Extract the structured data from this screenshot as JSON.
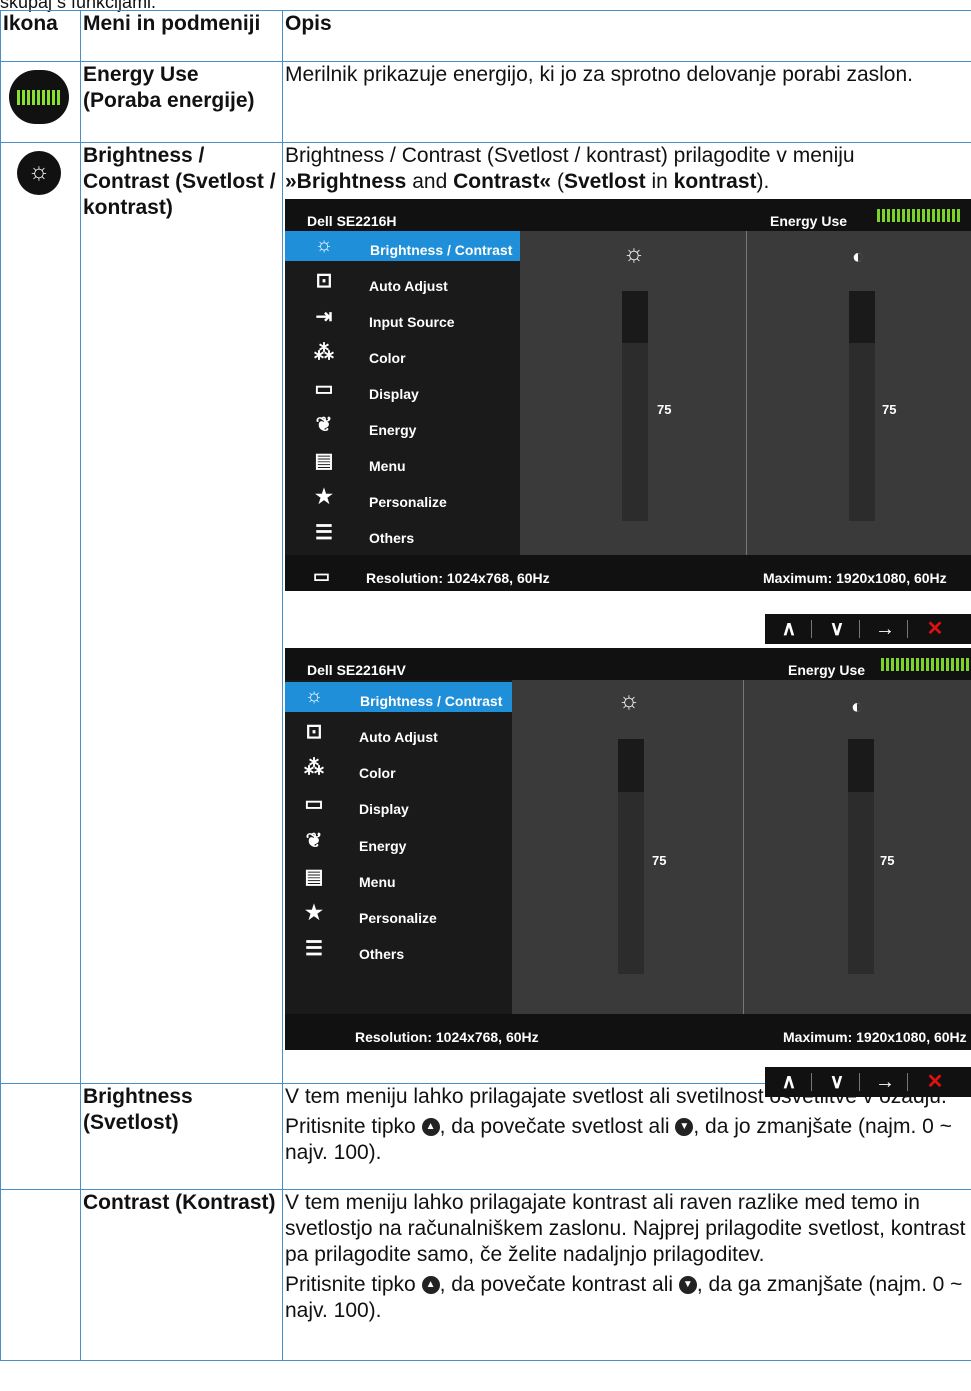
{
  "intro_text": "skupaj s funkcijami.",
  "table": {
    "headers": [
      "Ikona",
      "Meni in podmeniji",
      "Opis"
    ],
    "energy": {
      "icon": "energy-meter-icon",
      "name": "Energy Use (Poraba energije)",
      "desc": "Merilnik prikazuje energijo, ki jo za sprotno delovanje porabi zaslon."
    },
    "brightness_contrast": {
      "icon": "brightness-sun-icon",
      "name": "Brightness / Contrast (Svetlost / kontrast)",
      "desc_parts": [
        "Brightness / Contrast (Svetlost / kontrast) prilagodite v meniju ",
        "»Brightness",
        " and ",
        "Contrast«",
        " (",
        "Svetlost",
        " in ",
        "kontrast",
        ")."
      ]
    },
    "brightness": {
      "name": "Brightness (Svetlost)",
      "p1": "V tem meniju lahko prilagajate svetlost ali svetilnost osvetlitve v ozadju.",
      "p2a": "Pritisnite tipko ",
      "p2b": ", da povečate svetlost ali ",
      "p2c": ", da jo zmanjšate (najm. 0 ~ najv. 100)."
    },
    "contrast": {
      "name": "Contrast (Kontrast)",
      "p1": "V tem meniju lahko prilagajate kontrast ali raven razlike med temo in svetlostjo na računalniškem zaslonu. Najprej prilagodite svetlost, kontrast pa prilagodite samo, če želite nadaljnjo prilagoditev.",
      "p2a": "Pritisnite tipko ",
      "p2b": ", da povečate kontrast ali ",
      "p2c": ", da ga zmanjšate (najm. 0 ~ najv. 100)."
    }
  },
  "osd1": {
    "model": "Dell SE2216H",
    "energy_label": "Energy Use",
    "menu": [
      "Brightness / Contrast",
      "Auto Adjust",
      "Input Source",
      "Color",
      "Display",
      "Energy",
      "Menu",
      "Personalize",
      "Others"
    ],
    "brightness_value": "75",
    "contrast_value": "75",
    "brightness_level": 75,
    "contrast_level": 75,
    "resolution": "Resolution: 1024x768, 60Hz",
    "maximum": "Maximum: 1920x1080, 60Hz"
  },
  "osd2": {
    "model": "Dell SE2216HV",
    "energy_label": "Energy Use",
    "menu": [
      "Brightness / Contrast",
      "Auto Adjust",
      "Color",
      "Display",
      "Energy",
      "Menu",
      "Personalize",
      "Others"
    ],
    "brightness_value": "75",
    "contrast_value": "75",
    "brightness_level": 75,
    "contrast_level": 75,
    "resolution": "Resolution: 1024x768, 60Hz",
    "maximum": "Maximum: 1920x1080, 60Hz"
  },
  "nav": {
    "up": "∧",
    "down": "∨",
    "enter": "→",
    "close": "✕"
  },
  "colors": {
    "border": "#4a90c8",
    "highlight": "#1e8fd8",
    "energy_bar": "#7cd32a",
    "close": "#e01010"
  }
}
